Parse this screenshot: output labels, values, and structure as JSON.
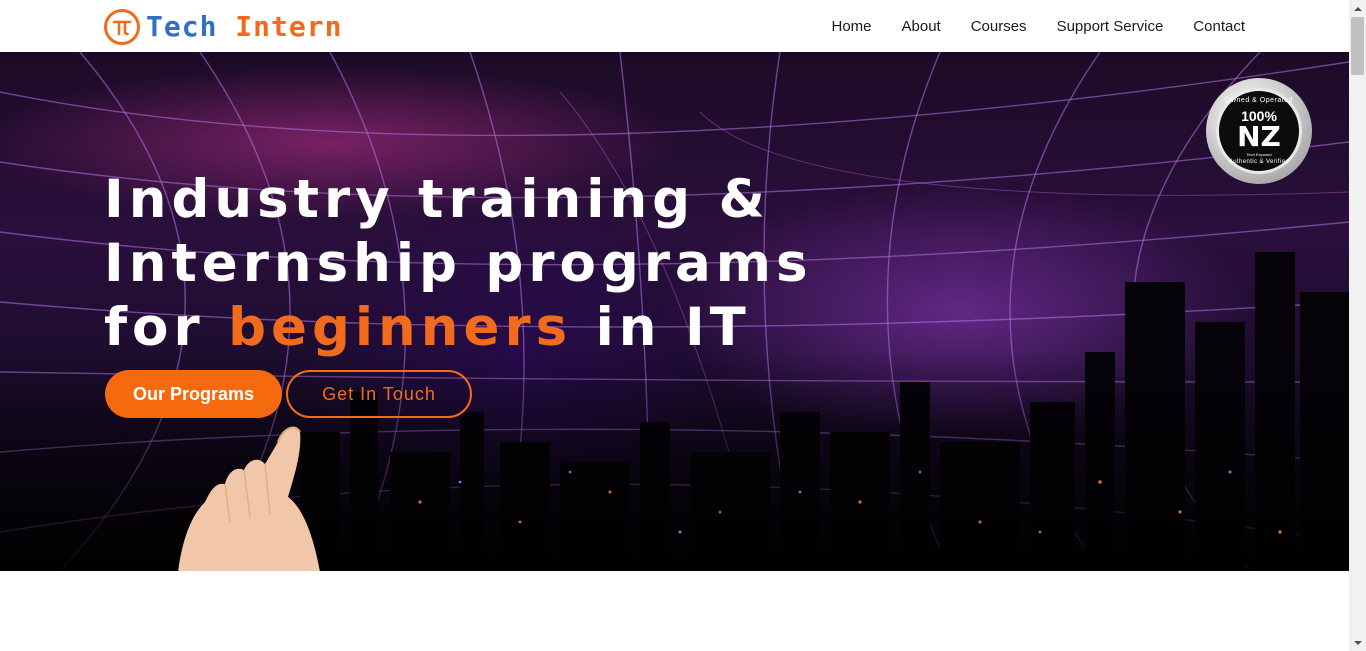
{
  "header": {
    "logo": {
      "word1": "Tech",
      "word2": "Intern"
    },
    "nav": [
      {
        "label": "Home"
      },
      {
        "label": "About"
      },
      {
        "label": "Courses"
      },
      {
        "label": "Support Service"
      },
      {
        "label": "Contact"
      }
    ]
  },
  "hero": {
    "title_line1": "Industry training &",
    "title_line2": "Internship programs",
    "title_line3_pre": "for",
    "title_line3_accent": "beginners",
    "title_line3_post": "in IT",
    "primary_button": "Our Programs",
    "secondary_button": "Get In Touch",
    "badge": {
      "top_text": "Owned & Operated",
      "percent": "100%",
      "country": "NZ",
      "sub_text": "Tech Exposed",
      "bottom_text": "Authentic & Verified"
    }
  },
  "colors": {
    "accent": "#f26b1d",
    "logo_blue": "#2f6fc9",
    "nav_text": "#1b1b1b"
  },
  "icons": [
    "logo-icon",
    "nz-badge-icon",
    "hand-image",
    "scroll-up-icon",
    "scroll-down-icon"
  ]
}
